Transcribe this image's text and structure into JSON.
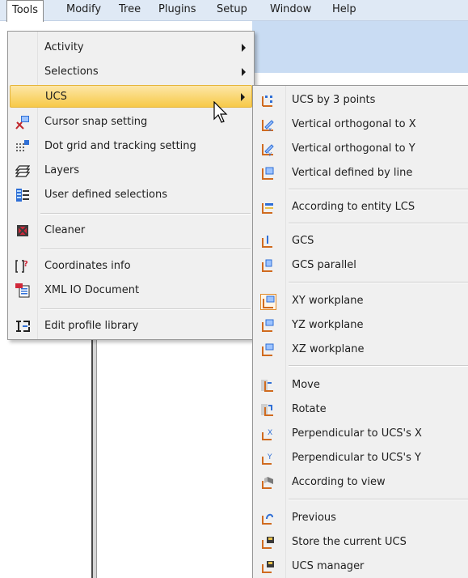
{
  "menubar": {
    "items": [
      "Tools",
      "Modify",
      "Tree",
      "Plugins",
      "Setup",
      "Window",
      "Help"
    ]
  },
  "tools_menu": {
    "activity": {
      "label": "Activity",
      "icon": "none"
    },
    "selections": {
      "label": "Selections",
      "icon": "none"
    },
    "ucs": {
      "label": "UCS",
      "icon": "none"
    },
    "cursor_snap": {
      "label": "Cursor snap setting",
      "icon": "cursor-snap-icon"
    },
    "dot_grid": {
      "label": "Dot grid and tracking setting",
      "icon": "dot-grid-icon"
    },
    "layers": {
      "label": "Layers",
      "icon": "layers-icon"
    },
    "user_selections": {
      "label": "User defined selections",
      "icon": "user-selections-icon"
    },
    "cleaner": {
      "label": "Cleaner",
      "icon": "cleaner-icon"
    },
    "coordinates_info": {
      "label": "Coordinates info",
      "icon": "coordinates-info-icon"
    },
    "xml_io": {
      "label": "XML IO Document",
      "icon": "xml-document-icon"
    },
    "profile_library": {
      "label": "Edit profile library",
      "icon": "profile-library-icon"
    }
  },
  "ucs_menu": {
    "by_3_points": "UCS by 3 points",
    "vertical_x": "Vertical orthogonal to X",
    "vertical_y": "Vertical orthogonal to Y",
    "vertical_line": "Vertical defined by line",
    "entity_lcs": "According to entity LCS",
    "gcs": "GCS",
    "gcs_parallel": "GCS parallel",
    "xy_workplane": "XY workplane",
    "yz_workplane": "YZ workplane",
    "xz_workplane": "XZ workplane",
    "move": "Move",
    "rotate": "Rotate",
    "perp_x": "Perpendicular to UCS's X",
    "perp_y": "Perpendicular to UCS's Y",
    "according_view": "According to view",
    "previous": "Previous",
    "store_current": "Store the current UCS",
    "manager": "UCS manager"
  },
  "colors": {
    "menubar_bg": "#dfe9f5",
    "menu_bg": "#f0f0f0",
    "highlight": "#f7c948",
    "pane_header": "#c9dcf3"
  }
}
